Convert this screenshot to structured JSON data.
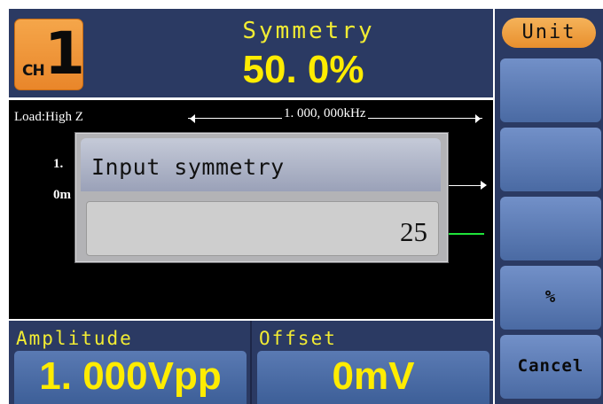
{
  "channel": {
    "prefix": "CH",
    "number": "1"
  },
  "header": {
    "title": "Symmetry",
    "value": "50. 0%"
  },
  "waveform": {
    "load_label": "Load:High Z",
    "frequency_label": "1. 000, 000kHz",
    "partial_text_1": "1.",
    "partial_text_2": "0m"
  },
  "dialog": {
    "title": "Input symmetry",
    "input_value": "25"
  },
  "fields": [
    {
      "label": "Amplitude",
      "value": "1. 000Vpp"
    },
    {
      "label": "Offset",
      "value": "0mV"
    }
  ],
  "softkeys": [
    {
      "label": "Unit"
    },
    {
      "label": ""
    },
    {
      "label": ""
    },
    {
      "label": ""
    },
    {
      "label": "%"
    },
    {
      "label": "Cancel"
    }
  ],
  "colors": {
    "panel": "#2b3a63",
    "accent_yellow": "#ffec00",
    "softkey_blue": "#5a7ab3",
    "badge_orange": "#f0a040",
    "trace_green": "#1fe33a"
  }
}
